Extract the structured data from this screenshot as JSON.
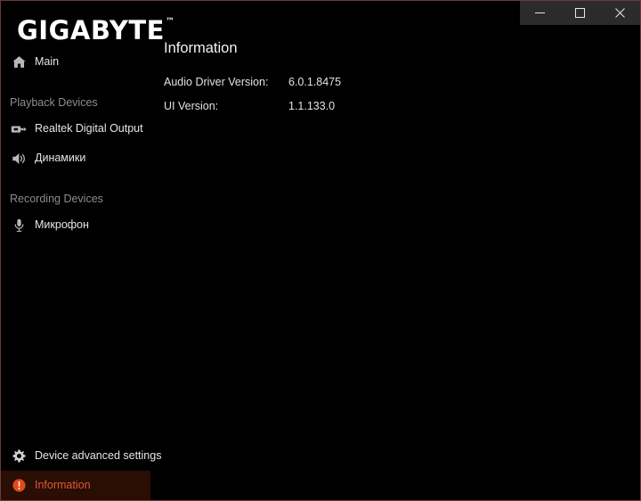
{
  "window": {
    "logo_text": "GIGABYTE",
    "logo_tm": "™",
    "controls": [
      {
        "name": "minimize",
        "glyph": "minimize-icon",
        "label": "Minimize"
      },
      {
        "name": "maximize",
        "glyph": "maximize-icon",
        "label": "Maximize"
      },
      {
        "name": "close",
        "glyph": "close-icon",
        "label": "Close"
      }
    ],
    "border_color": "#6b3b35",
    "background_color": "#000000",
    "controls_background": "#2b2b2b"
  },
  "sidebar": {
    "main_item": {
      "label": "Main",
      "icon": "home-icon"
    },
    "playback_group": {
      "header": "Playback Devices",
      "items": [
        {
          "label": "Realtek Digital Output",
          "icon": "spdif-icon"
        },
        {
          "label": "Динамики",
          "icon": "speaker-icon"
        }
      ]
    },
    "recording_group": {
      "header": "Recording Devices",
      "items": [
        {
          "label": "Микрофон",
          "icon": "microphone-icon"
        }
      ]
    },
    "bottom_items": [
      {
        "label": "Device advanced settings",
        "icon": "gear-icon",
        "selected": false
      },
      {
        "label": "Information",
        "icon": "info-alert-icon",
        "selected": true
      }
    ],
    "selected_background": "#2a0d03",
    "selected_text_color": "#e0593a",
    "accent_color": "#e04a1e",
    "group_header_color": "#8d8d8d"
  },
  "main": {
    "title": "Information",
    "rows": [
      {
        "key": "Audio Driver Version:",
        "value": "6.0.1.8475"
      },
      {
        "key": "UI Version:",
        "value": "1.1.133.0"
      }
    ]
  }
}
